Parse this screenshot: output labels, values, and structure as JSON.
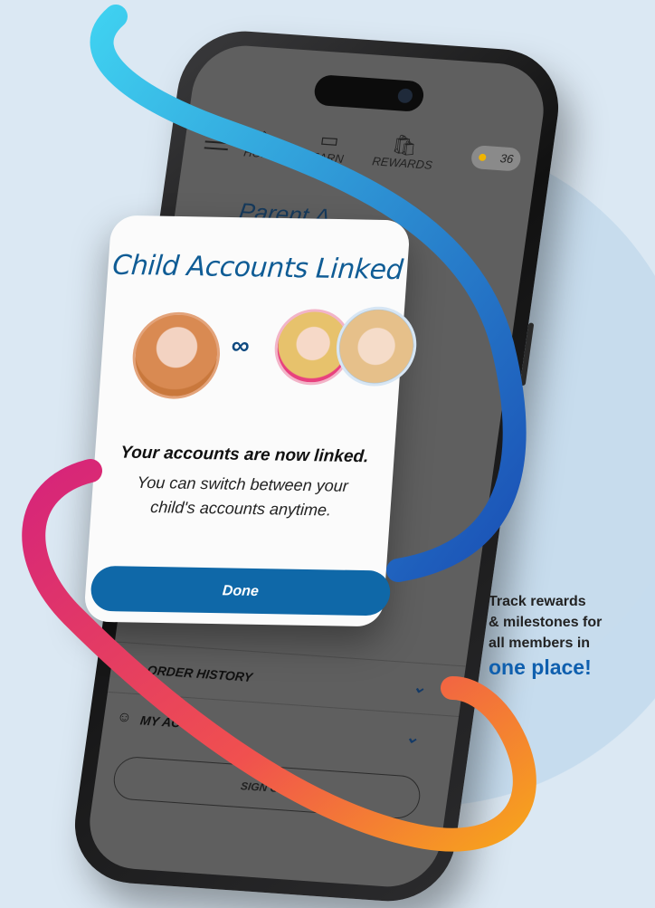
{
  "app": {
    "nav": [
      {
        "label": "HOME",
        "icon": "home-icon"
      },
      {
        "label": "EARN",
        "icon": "earn-icon"
      },
      {
        "label": "REWARDS",
        "icon": "bag-icon"
      }
    ],
    "points": "36",
    "page_title": "Parent A",
    "rows": [
      {
        "label": "ORDER HISTORY"
      },
      {
        "label": "MY ACTIVI"
      }
    ],
    "sign_out": "SIGN OUT"
  },
  "modal": {
    "title": "Child Accounts Linked",
    "message_strong": "Your accounts are now linked.",
    "message_line1": "You can switch between your",
    "message_line2": "child's accounts anytime.",
    "done_label": "Done"
  },
  "promo": {
    "line1": "Track rewards",
    "line2": "& milestones for",
    "line3": "all members in",
    "highlight": "one place!"
  },
  "colors": {
    "accent": "#0f68a8",
    "title": "#0f5c95",
    "ribbon_start": "#3fd0f0",
    "ribbon_mid": "#1a4fb5",
    "ribbon_pink": "#d6247a",
    "ribbon_orange": "#f7a41c"
  }
}
